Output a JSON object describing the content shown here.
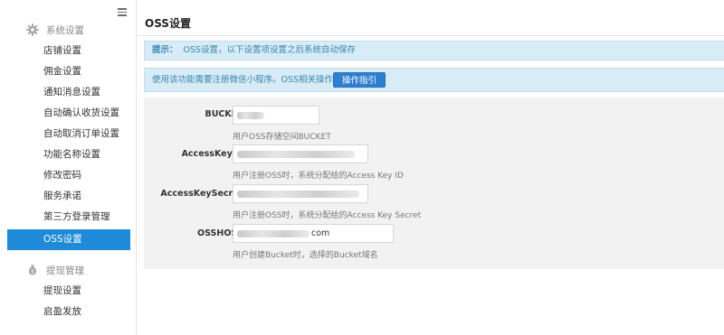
{
  "sidebar": {
    "groups": [
      {
        "label": "系统设置",
        "icon": "gear-icon",
        "items": [
          "店铺设置",
          "佣金设置",
          "通知消息设置",
          "自动确认收货设置",
          "自动取消订单设置",
          "功能名称设置",
          "修改密码",
          "服务承诺",
          "第三方登录管理",
          "OSS设置"
        ]
      },
      {
        "label": "提现管理",
        "icon": "money-bag-icon",
        "items": [
          "提现设置",
          "启盈发放"
        ]
      }
    ],
    "active_item": "OSS设置"
  },
  "main": {
    "title": "OSS设置",
    "tip": {
      "label": "提示：",
      "text": "OSS设置，以下设置项设置之后系统自动保存"
    },
    "guide": {
      "text": "使用该功能需要注册微信小程序。OSS相关操作指引。",
      "button": "操作指引"
    },
    "fields": [
      {
        "label": "BUCKET:",
        "value": "",
        "help": "用户OSS存储空间BUCKET"
      },
      {
        "label": "AccessKeyID:",
        "value": "",
        "help": "用户注册OSS时，系统分配给的Access Key ID"
      },
      {
        "label": "AccessKeySecret:",
        "value": "",
        "help": "用户注册OSS时，系统分配给的Access Key Secret"
      },
      {
        "label": "OSSHOST:",
        "value": "com",
        "help": "用户创建Bucket时，选择的Bucket域名"
      }
    ]
  },
  "colors": {
    "accent": "#1e8ad8",
    "button": "#2f7fd0",
    "alert_bg": "#d7ecf7",
    "alert_text": "#3a87ad",
    "panel_bg": "#f2f2f2"
  }
}
